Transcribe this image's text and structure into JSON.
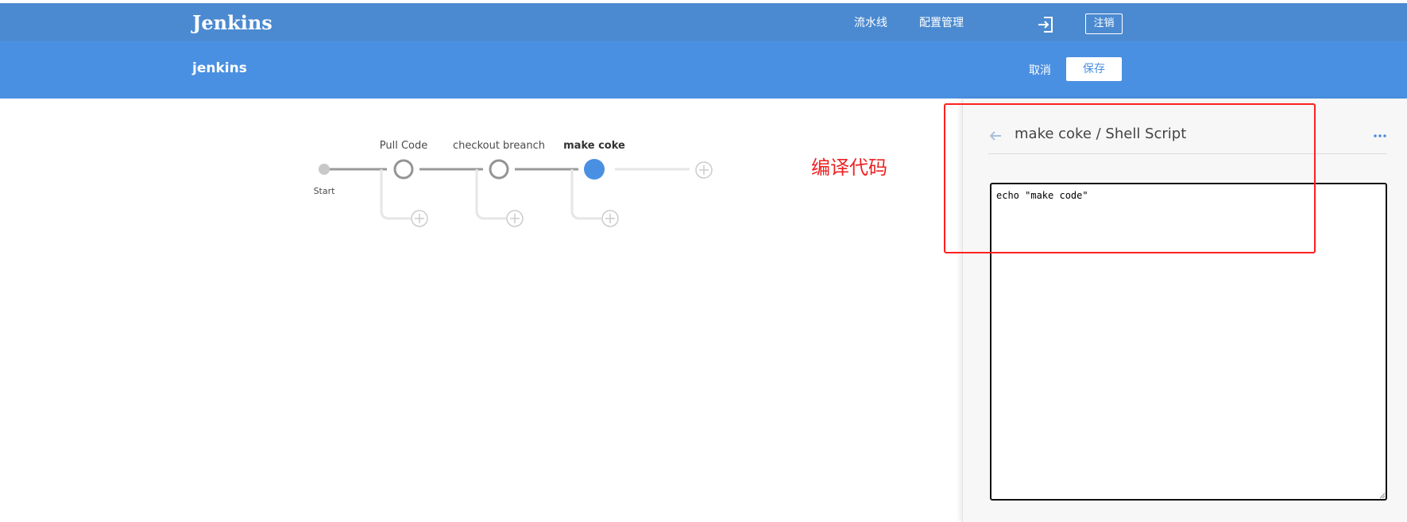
{
  "app": {
    "brand": "Jenkins"
  },
  "nav": {
    "pipelines": "流水线",
    "config": "配置管理",
    "logout": "注销"
  },
  "subheader": {
    "pipeline_name": "jenkins",
    "cancel": "取消",
    "save": "保存"
  },
  "pipeline": {
    "start_label": "Start",
    "stages": [
      {
        "name": "Pull Code",
        "state": "completed"
      },
      {
        "name": "checkout breanch",
        "state": "completed"
      },
      {
        "name": "make coke",
        "state": "selected"
      }
    ]
  },
  "annotation": "编译代码",
  "editor": {
    "title": "make coke / Shell Script",
    "script": "echo \"make code\""
  },
  "colors": {
    "topbar": "#4b8ad0",
    "subbar": "#4a90e2",
    "selected_stage": "#4a90e2",
    "annotation": "#ee2222"
  }
}
